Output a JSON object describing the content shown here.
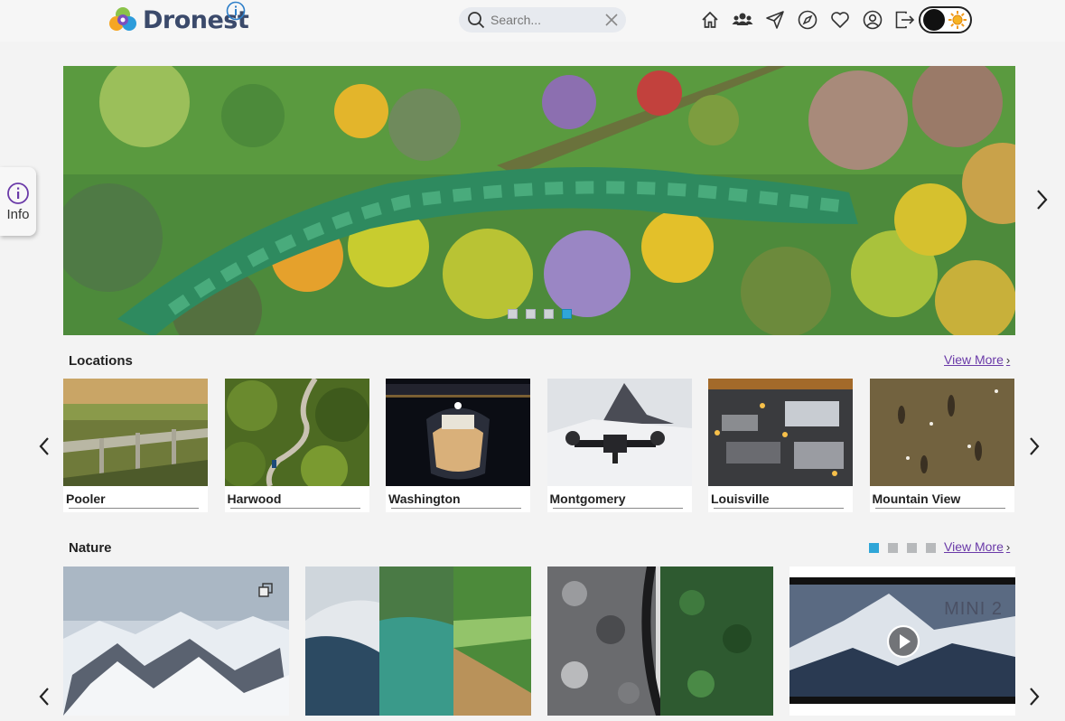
{
  "header": {
    "brand": "Dronest",
    "search_placeholder": "Search...",
    "nav_icons": [
      "home-icon",
      "users-icon",
      "send-icon",
      "compass-icon",
      "heart-icon",
      "user-icon",
      "logout-icon"
    ]
  },
  "side_tab": {
    "label": "Info"
  },
  "hero": {
    "slide_count": 4,
    "active_slide": 4
  },
  "locations": {
    "title": "Locations",
    "view_more": "View More",
    "items": [
      {
        "label": "Pooler"
      },
      {
        "label": "Harwood"
      },
      {
        "label": "Washington"
      },
      {
        "label": "Montgomery"
      },
      {
        "label": "Louisville"
      },
      {
        "label": "Mountain View"
      }
    ]
  },
  "nature": {
    "title": "Nature",
    "view_more": "View More",
    "page_count": 4,
    "active_page": 1,
    "video_overlay_text": "MINI 2"
  },
  "colors": {
    "accent": "#2fa6d8",
    "link": "#6a3aa8",
    "brand_text": "#3b4a6b"
  }
}
